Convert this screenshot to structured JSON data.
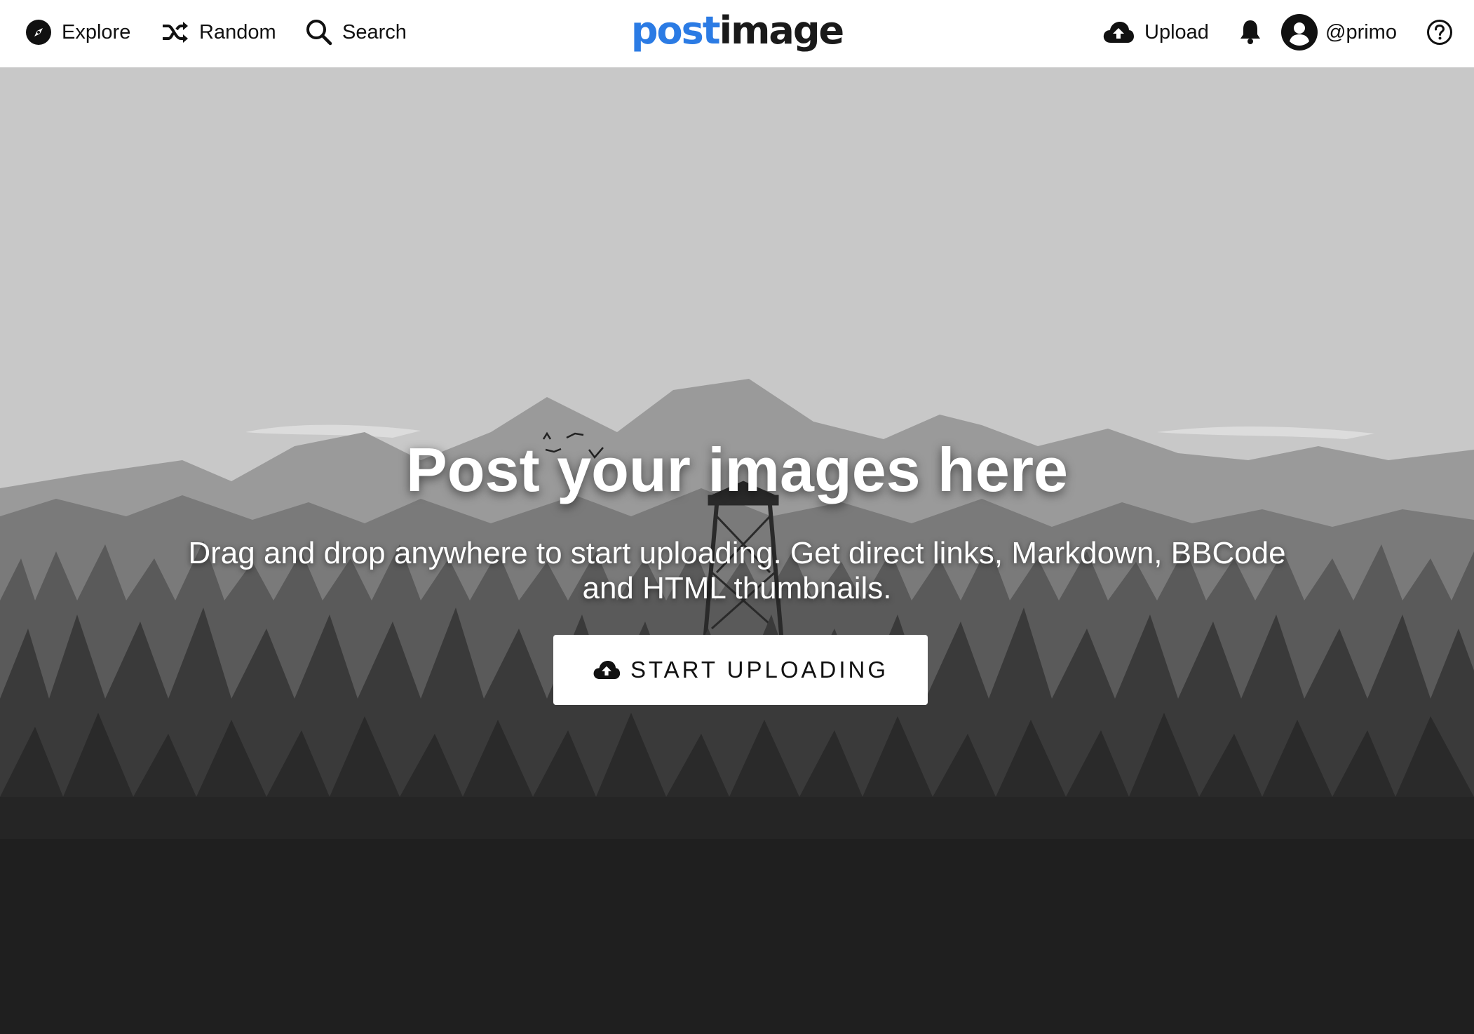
{
  "nav": {
    "explore_label": "Explore",
    "random_label": "Random",
    "search_label": "Search",
    "upload_label": "Upload",
    "username": "@primo"
  },
  "logo": {
    "part_a": "post",
    "part_b": "image",
    "accent_color": "#2b7be4"
  },
  "hero": {
    "title": "Post your images here",
    "subtitle": "Drag and drop anywhere to start uploading. Get direct links, Markdown, BBCode and HTML thumbnails.",
    "cta_label": "START UPLOADING"
  },
  "icons": {
    "explore": "compass-icon",
    "random": "shuffle-icon",
    "search": "search-icon",
    "upload": "cloud-upload-icon",
    "notifications": "bell-icon",
    "user": "user-avatar-icon",
    "help": "help-icon"
  }
}
